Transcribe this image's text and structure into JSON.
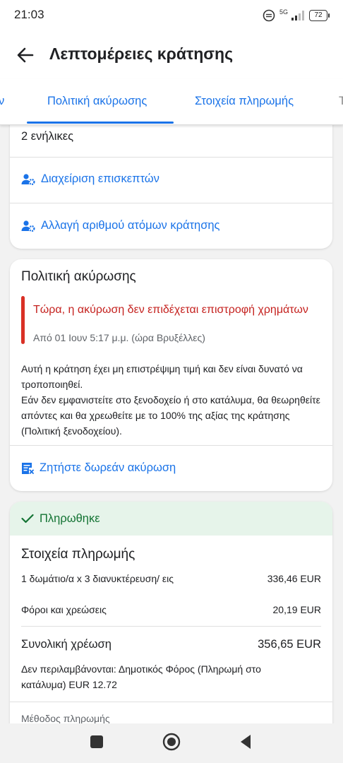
{
  "status_bar": {
    "time": "21:03",
    "network": "5G",
    "battery": "72"
  },
  "header": {
    "title": "Λεπτομέρειες κράτησης"
  },
  "tabs": [
    {
      "label": "Πολιτική ακύρωσης",
      "active": true
    },
    {
      "label": "Στοιχεία πληρωμής",
      "active": false
    }
  ],
  "guests_card": {
    "guests_text": "2 ενήλικες",
    "links": [
      {
        "label": "Διαχείριση επισκεπτών",
        "icon": "manage-accounts-icon"
      },
      {
        "label": "Αλλαγή αριθμού ατόμων κράτησης",
        "icon": "manage-accounts-icon"
      }
    ]
  },
  "cancellation_card": {
    "title": "Πολιτική ακύρωσης",
    "alert_title": "Τώρα, η ακύρωση δεν επιδέχεται επιστροφή χρημάτων",
    "alert_subtitle": "Από 01 Ιουν 5:17 μ.μ. (ώρα Βρυξέλλες)",
    "paragraph_1": "Αυτή η κράτηση έχει μη επιστρέψιμη τιμή και δεν είναι δυνατό να τροποποιηθεί.",
    "paragraph_2": "Εάν δεν εμφανιστείτε στο ξενοδοχείο ή στο κατάλυμα, θα θεωρηθείτε απόντες και θα χρεωθείτε με το 100% της αξίας της κράτησης (Πολιτική ξενοδοχείου).",
    "link": "Ζητήστε δωρεάν ακύρωση"
  },
  "payment_card": {
    "paid_label": "Πληρωθηκε",
    "title": "Στοιχεία πληρωμής",
    "line_items": [
      {
        "label": "1 δωμάτιο/α x 3 διανυκτέρευση/ εις",
        "amount": "336,46 EUR"
      },
      {
        "label": "Φόροι και χρεώσεις",
        "amount": "20,19 EUR"
      }
    ],
    "total_label": "Συνολική χρέωση",
    "total_amount": "356,65 EUR",
    "excluded_note": "Δεν περιλαμβάνονται: Δημοτικός Φόρος (Πληρωμή στο κατάλυμα) EUR 12.72",
    "payment_method_label": "Μέθοδος πληρωμής"
  },
  "colors": {
    "accent": "#1a73e8",
    "alert_red": "#c5221f",
    "alert_bar": "#d93025",
    "paid_bg": "#e6f4ea",
    "paid_text": "#137333"
  }
}
